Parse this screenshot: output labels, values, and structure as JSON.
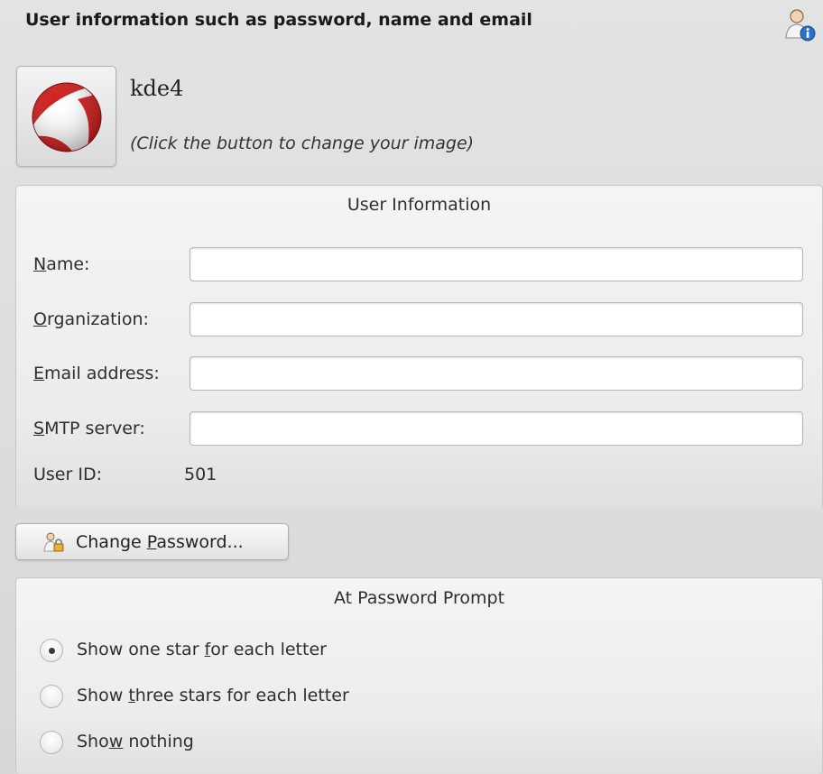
{
  "header": {
    "title": "User information such as password, name and email",
    "icon": "user-info-icon"
  },
  "profile": {
    "avatar_icon": "beach-ball-icon",
    "username": "kde4",
    "avatar_hint": "(Click the button to change your image)"
  },
  "user_information": {
    "title": "User Information",
    "fields": [
      {
        "label": "Name:",
        "mnemonic_index": 0,
        "value": ""
      },
      {
        "label": "Organization:",
        "mnemonic_index": 0,
        "value": ""
      },
      {
        "label": "Email address:",
        "mnemonic_index": 0,
        "value": ""
      },
      {
        "label": "SMTP server:",
        "mnemonic_index": 0,
        "value": ""
      }
    ],
    "user_id_label": "User ID:",
    "user_id_value": "501"
  },
  "change_password": {
    "label": "Change Password...",
    "mnemonic_index": 7,
    "icon": "lock-user-icon"
  },
  "password_prompt": {
    "title": "At Password Prompt",
    "options": [
      {
        "label": "Show one star for each letter",
        "mnemonic_index": 14,
        "checked": true
      },
      {
        "label": "Show three stars for each letter",
        "mnemonic_index": 5,
        "checked": false
      },
      {
        "label": "Show nothing",
        "mnemonic_index": 3,
        "checked": false
      }
    ]
  },
  "colors": {
    "background": "#dcdcdc",
    "ball_red": "#d01818",
    "ball_white": "#ffffff"
  }
}
